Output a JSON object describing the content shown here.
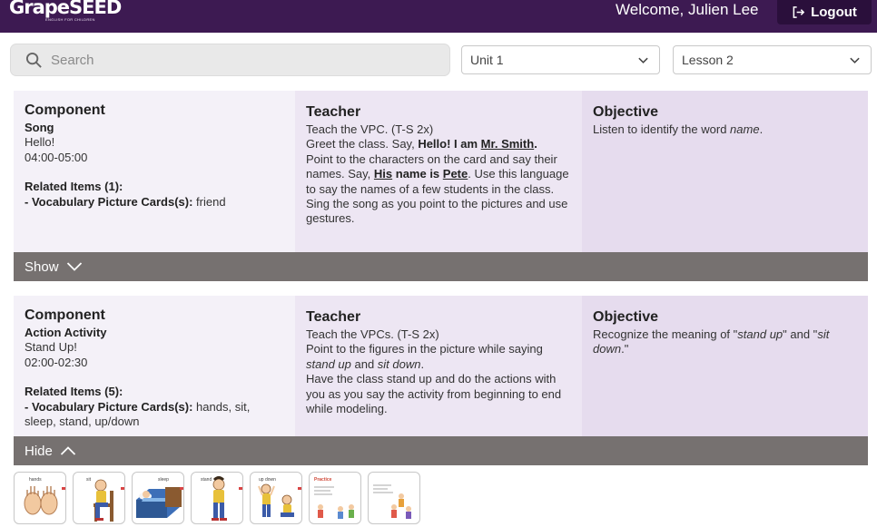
{
  "header": {
    "logo_text": "GrapeSEED",
    "logo_tagline": "ENGLISH FOR CHILDREN",
    "welcome": "Welcome, Julien Lee",
    "logout_label": "Logout"
  },
  "toolbar": {
    "search_placeholder": "Search",
    "unit_selected": "Unit 1",
    "lesson_selected": "Lesson 2"
  },
  "cards": [
    {
      "component_heading": "Component",
      "component_type": "Song",
      "name": "Hello!",
      "time": "04:00-05:00",
      "related_heading": "Related Items (1):",
      "related_prefix": "- ",
      "related_label": "Vocabulary Picture Cards(s):",
      "related_items": " friend",
      "teacher_heading": "Teacher",
      "teacher_line1": "Teach the VPC. (T-S 2x)",
      "teacher_greet_pre": "Greet the class. Say, ",
      "teacher_greet_bold": "Hello! I am ",
      "teacher_greet_name": "Mr. Smith",
      "teacher_greet_end": ".",
      "teacher_point_pre": "Point to the characters on the card and say their names. Say, ",
      "teacher_point_his": "His",
      "teacher_point_mid": " name is ",
      "teacher_point_name": "Pete",
      "teacher_point_end": ". Use this language to say the names of a few students in the class.",
      "teacher_sing": "Sing the song as you point to the pictures and use gestures.",
      "objective_heading": "Objective",
      "objective_pre": "Listen to identify the word ",
      "objective_em": "name",
      "objective_end": ".",
      "toggle_label": "Show"
    },
    {
      "component_heading": "Component",
      "component_type": "Action Activity",
      "name": "Stand Up!",
      "time": "02:00-02:30",
      "related_heading": "Related Items (5):",
      "related_prefix": "- ",
      "related_label": "Vocabulary Picture Cards(s):",
      "related_items": " hands, sit, sleep, stand, up/down",
      "teacher_heading": "Teacher",
      "teacher_line1": "Teach the VPCs. (T-S 2x)",
      "teacher_point_pre": "Point to the figures in the picture while saying ",
      "teacher_point_em1": "stand up",
      "teacher_point_and": " and ",
      "teacher_point_em2": "sit down",
      "teacher_point_end": ".",
      "teacher_have": "Have the class stand up and do the actions with you as you say the activity from beginning to end while modeling.",
      "objective_heading": "Objective",
      "objective_pre": "Recognize the meaning of \"",
      "objective_em1": "stand up",
      "objective_mid": "\" and \"",
      "objective_em2": "sit down",
      "objective_end": ".\"",
      "toggle_label": "Hide"
    }
  ],
  "thumbnails": [
    {
      "label": "hands",
      "icon": "hands-card-icon"
    },
    {
      "label": "sit",
      "icon": "sit-card-icon"
    },
    {
      "label": "sleep",
      "icon": "sleep-card-icon"
    },
    {
      "label": "stand",
      "icon": "stand-card-icon"
    },
    {
      "label": "up   down",
      "icon": "up-down-card-icon"
    },
    {
      "label": "Practice",
      "icon": "activity-card-icon"
    },
    {
      "label": "",
      "icon": "activity-card-icon"
    }
  ],
  "colors": {
    "header_bg": "#3d1a52",
    "logout_bg": "#2a0f3b",
    "component_bg": "#f4f1f8",
    "teacher_bg": "#ede6f3",
    "objective_bg": "#e6dcee",
    "toggle_bg": "#767170"
  }
}
